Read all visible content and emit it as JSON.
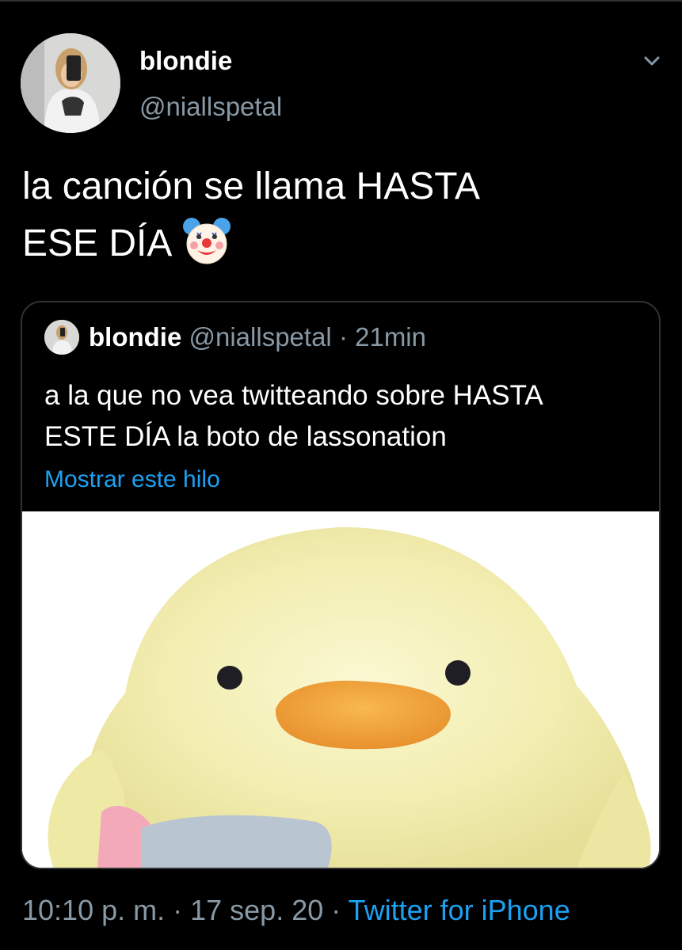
{
  "tweet": {
    "author_name": "blondie",
    "author_handle": "@niallspetal",
    "text_lines": [
      "la canción se llama HASTA",
      "ESE DÍA"
    ],
    "emoji_icon": "clown-face-icon",
    "quoted": {
      "author_name": "blondie",
      "author_handle": "@niallspetal",
      "separator": "·",
      "time": "21min",
      "text_lines": [
        "a la que no vea twitteando sobre HASTA",
        "ESTE DÍA la boto de lassonation"
      ],
      "show_thread_label": "Mostrar este hilo",
      "image": "yellow-duck-plush"
    },
    "meta": {
      "time": "10:10 p. m.",
      "separator1": " · ",
      "date": "17 sep. 20",
      "separator2": " · ",
      "source": "Twitter for iPhone"
    }
  },
  "colors": {
    "background": "#000000",
    "secondary_text": "#8899a6",
    "link": "#1da1f2",
    "border": "#2f3336",
    "duck_body": "#f4f0b4",
    "duck_beak": "#f0a53a"
  }
}
